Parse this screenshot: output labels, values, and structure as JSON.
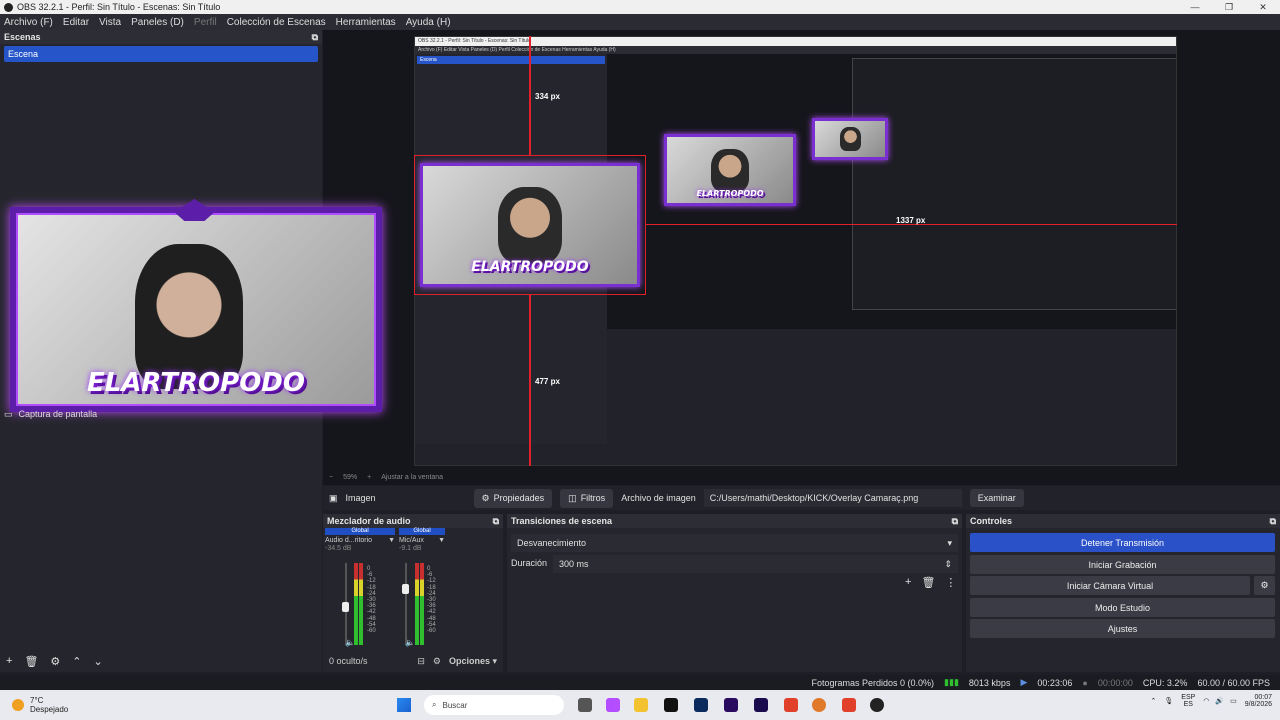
{
  "window": {
    "title": "OBS 32.2.1 - Perfil: Sin Título - Escenas: Sin Título"
  },
  "menu": [
    "Archivo (F)",
    "Editar",
    "Vista",
    "Paneles (D)",
    "Perfil",
    "Colección de Escenas",
    "Herramientas",
    "Ayuda (H)"
  ],
  "scenes": {
    "header": "Escenas",
    "items": [
      "Escena"
    ]
  },
  "sources": {
    "item": "Captura de pantalla"
  },
  "overlay_brand": "ELARTROPODO",
  "measurements": {
    "top": "334 px",
    "bottom": "477 px",
    "right": "1337 px"
  },
  "zoom": {
    "minus": "−",
    "value": "59%",
    "plus": "+",
    "fit": "Ajustar a la ventana"
  },
  "context": {
    "source_name": "Imagen",
    "properties": "Propiedades",
    "filters": "Filtros",
    "file_label": "Archivo de imagen",
    "file_path": "C:/Users/mathi/Desktop/KICK/Overlay Camaraç.png",
    "browse": "Examinar"
  },
  "mixer": {
    "header": "Mezclador de audio",
    "channels": [
      {
        "badge": "Global",
        "name": "Audio d...ritorio",
        "db": "-34.5 dB"
      },
      {
        "badge": "Global",
        "name": "Mic/Aux",
        "db": "-9.1 dB"
      }
    ],
    "ticks": [
      "0",
      "-6",
      "-12",
      "-18",
      "-24",
      "-30",
      "-36",
      "-42",
      "-48",
      "-54",
      "-60"
    ],
    "hidden": "0 oculto/s",
    "options": "Opciones"
  },
  "transitions": {
    "header": "Transiciones de escena",
    "selected": "Desvanecimiento",
    "duration_label": "Duración",
    "duration_value": "300 ms"
  },
  "controls": {
    "header": "Controles",
    "stop_stream": "Detener Transmisión",
    "start_record": "Iniciar Grabación",
    "virtual_cam": "Iniciar Cámara Virtual",
    "studio_mode": "Modo Estudio",
    "settings": "Ajustes"
  },
  "status": {
    "dropped": "Fotogramas Perdidos 0 (0.0%)",
    "bitrate": "8013 kbps",
    "stream_time": "00:23:06",
    "rec_time": "00:00:00",
    "cpu": "CPU: 3.2%",
    "fps": "60.00 / 60.00 FPS"
  },
  "taskbar": {
    "temp": "7°C",
    "weather": "Despejado",
    "search": "Buscar",
    "lang1": "ESP",
    "lang2": "ES",
    "time": "00:07",
    "date": "9/8/2026"
  },
  "colors": {
    "accent": "#2a51c7",
    "overlay_purple": "#7a2fd0",
    "guide_red": "#e0202a"
  }
}
